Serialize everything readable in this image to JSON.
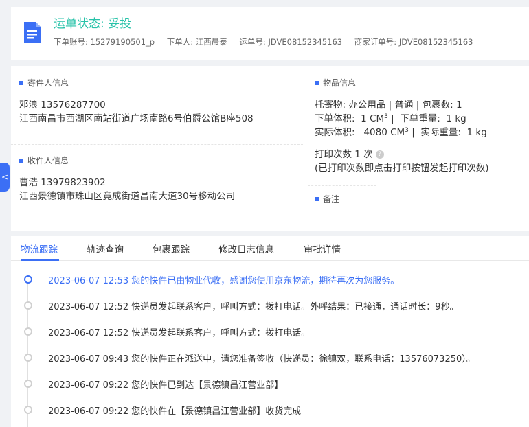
{
  "header": {
    "status": "运单状态: 妥投",
    "order_account_label": "下单账号:",
    "order_account": "15279190501_p",
    "orderer_label": "下单人:",
    "orderer": "江西晨泰",
    "waybill_label": "运单号:",
    "waybill": "JDVE08152345163",
    "merchant_order_label": "商家订单号:",
    "merchant_order": "JDVE08152345163"
  },
  "sender": {
    "title": "寄件人信息",
    "name_phone": "邓浪   13576287700",
    "address": "江西南昌市西湖区南站街道广场南路6号伯爵公馆B座508"
  },
  "receiver": {
    "title": "收件人信息",
    "name_phone": "曹浩   13979823902",
    "address": "江西景德镇市珠山区竟成街道昌南大道30号移动公司"
  },
  "goods": {
    "title": "物品信息",
    "consign_line": "托寄物:  办公用品 | 普通  |  包裹数:  1",
    "order_volume_label": "下单体积:",
    "order_volume": "1 CM",
    "order_weight_label": "下单重量:",
    "order_weight": "1 kg",
    "actual_volume_label": "实际体积:",
    "actual_volume": "4080 CM",
    "actual_weight_label": "实际重量:",
    "actual_weight": "1 kg",
    "volume_exp": "3",
    "print_count": "打印次数   1 次",
    "print_note": "(已打印次数即点击打印按钮发起打印次数)"
  },
  "remark": {
    "title": "备注"
  },
  "side_tab": {
    "label": "<"
  },
  "tabs": [
    "物流跟踪",
    "轨迹查询",
    "包裹跟踪",
    "修改日志信息",
    "审批详情"
  ],
  "events": [
    "2023-06-07 12:53 您的快件已由物业代收，感谢您使用京东物流，期待再次为您服务。",
    "2023-06-07 12:52 快递员发起联系客户，呼叫方式：拨打电话。外呼结果：已接通，通话时长：9秒。",
    "2023-06-07 12:52 快递员发起联系客户，呼叫方式：拨打电话。",
    "2023-06-07 09:43 您的快件正在派送中，请您准备签收（快递员：徐镇双，联系电话：13576073250）。",
    "2023-06-07 09:22 您的快件已到达【景德镇昌江营业部】",
    "2023-06-07 09:22 您的快件在【景德镇昌江营业部】收货完成"
  ],
  "colors": {
    "accent": "#3b6ff5",
    "status": "#27c2a8"
  }
}
